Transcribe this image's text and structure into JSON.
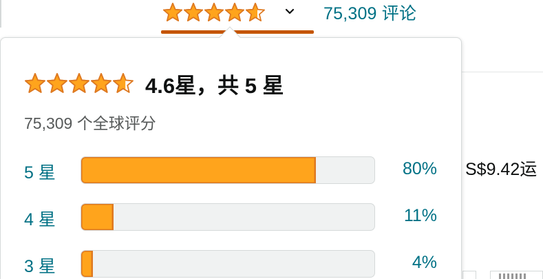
{
  "colors": {
    "star": "#ffa41c",
    "star_stroke": "#de7921",
    "link": "#007185",
    "underline": "#c45500",
    "bar_track": "#f0f2f2"
  },
  "header": {
    "rating_value": 4.6,
    "chevron_icon": "chevron-down-icon",
    "review_link": "75,309 评论"
  },
  "popover": {
    "title": "4.6星，共 5 星",
    "global_ratings": "75,309 个全球评分",
    "histogram": [
      {
        "label": "5 星",
        "percent_text": "80%",
        "percent": 80
      },
      {
        "label": "4 星",
        "percent_text": "11%",
        "percent": 11
      },
      {
        "label": "3 星",
        "percent_text": "4%",
        "percent": 4
      }
    ]
  },
  "background": {
    "price_snippet": "S$9.42运"
  }
}
